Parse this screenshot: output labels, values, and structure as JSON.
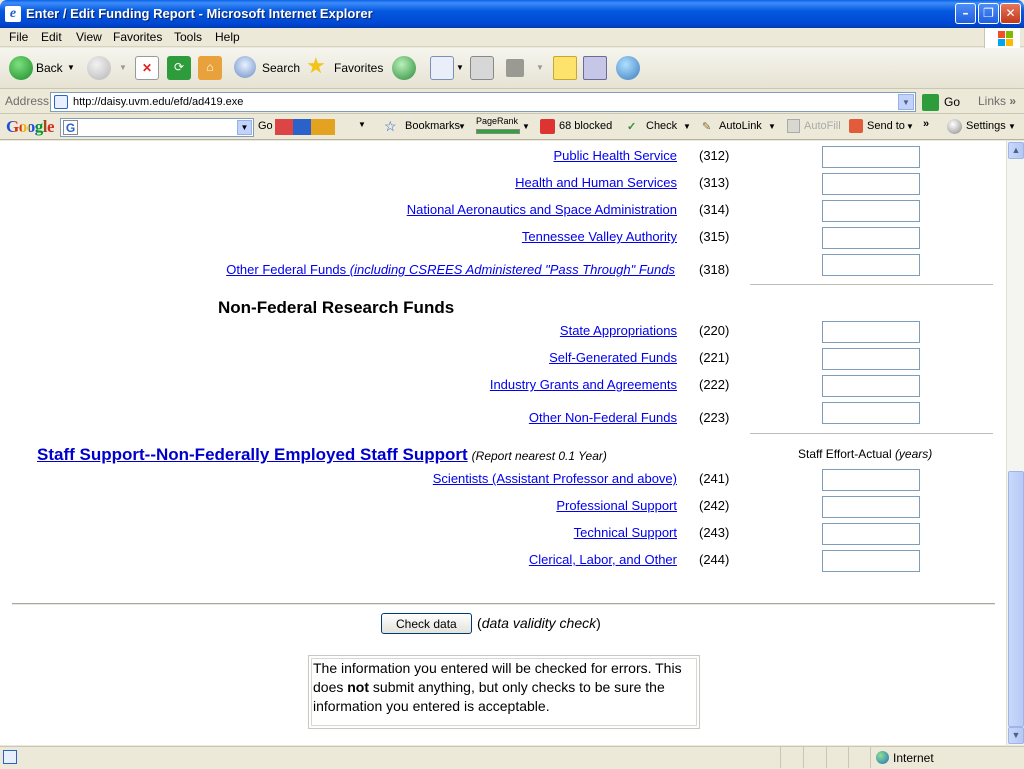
{
  "window": {
    "title": "Enter / Edit Funding Report - Microsoft Internet Explorer"
  },
  "menu": [
    "File",
    "Edit",
    "View",
    "Favorites",
    "Tools",
    "Help"
  ],
  "toolbar": {
    "back": "Back",
    "search": "Search",
    "favorites": "Favorites"
  },
  "address": {
    "label": "Address",
    "url": "http://daisy.uvm.edu/efd/ad419.exe",
    "go": "Go",
    "links": "Links"
  },
  "google_toolbar": {
    "logo": "Google",
    "go": "Go",
    "bookmarks": "Bookmarks",
    "pagerank": "PageRank",
    "blocked": "68 blocked",
    "check": "Check",
    "autolink": "AutoLink",
    "autofill": "AutoFill",
    "send_to": "Send to",
    "settings": "Settings"
  },
  "federal_rows": [
    {
      "label": "Public Health Service",
      "label_emph": "",
      "code": "(312)",
      "value": ""
    },
    {
      "label": "Health and Human Services",
      "label_emph": "",
      "code": "(313)",
      "value": ""
    },
    {
      "label": "National Aeronautics and Space Administration",
      "label_emph": "",
      "code": "(314)",
      "value": ""
    },
    {
      "label": "Tennessee Valley Authority",
      "label_emph": "",
      "code": "(315)",
      "value": ""
    },
    {
      "label": "Other Federal Funds ",
      "label_emph": "(including CSREES Administered \"Pass Through\" Funds",
      "code": "(318)",
      "value": ""
    }
  ],
  "nonfederal": {
    "heading": "Non-Federal Research Funds",
    "rows": [
      {
        "label": "State Appropriations",
        "code": "(220)",
        "value": ""
      },
      {
        "label": "Self-Generated Funds",
        "code": "(221)",
        "value": ""
      },
      {
        "label": "Industry Grants and Agreements",
        "code": "(222)",
        "value": ""
      },
      {
        "label": "Other Non-Federal Funds",
        "code": "(223)",
        "value": ""
      }
    ]
  },
  "staff": {
    "heading": "Staff Support--Non-Federally Employed Staff Support",
    "note": "(Report nearest 0.1 Year)",
    "effort_header": "Staff Effort-Actual ",
    "effort_unit": "(years)",
    "rows": [
      {
        "label": "Scientists (Assistant Professor and above)",
        "code": "(241)",
        "value": ""
      },
      {
        "label": "Professional Support",
        "code": "(242)",
        "value": ""
      },
      {
        "label": "Technical Support",
        "code": "(243)",
        "value": ""
      },
      {
        "label": "Clerical, Labor, and Other",
        "code": "(244)",
        "value": ""
      }
    ]
  },
  "check": {
    "button": "Check data",
    "note_open": "(",
    "note": "data validity check",
    "note_close": ")",
    "info_1": "The information you entered will be checked for errors. This does ",
    "info_bold": "not",
    "info_2": " submit anything, but only checks to be sure the information you entered is acceptable."
  },
  "status": {
    "zone": "Internet"
  }
}
